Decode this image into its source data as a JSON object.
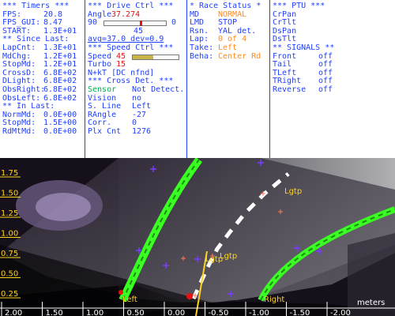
{
  "timers": {
    "title": "*** Timers ***",
    "rows": [
      {
        "k": "FPS:",
        "v": "20.8"
      },
      {
        "k": "FPS_GUI:",
        "v": "8.47"
      },
      {
        "k": "START:",
        "v": "1.3E+01"
      }
    ],
    "since_title": "** Since Last:",
    "since_rows": [
      {
        "k": "LapCnt:",
        "v": "1.3E+01"
      },
      {
        "k": "MdChg:",
        "v": "1.2E+01"
      },
      {
        "k": "StopMd:",
        "v": "1.2E+01"
      },
      {
        "k": "CrossD:",
        "v": "6.8E+02"
      },
      {
        "k": "DLight:",
        "v": "6.8E+02"
      },
      {
        "k": "ObsRight:",
        "v": "6.8E+02"
      },
      {
        "k": "ObsLeft:",
        "v": "6.8E+02"
      }
    ],
    "inlast_title": "** In Last:",
    "inlast_rows": [
      {
        "k": "NormMd:",
        "v": "0.0E+00"
      },
      {
        "k": "StopMd:",
        "v": "1.5E+00"
      },
      {
        "k": "RdMtMd:",
        "v": "0.0E+00"
      }
    ]
  },
  "drive": {
    "title": "***  Drive Ctrl  ***",
    "angle_label": "Angle",
    "angle_value": "37.274",
    "range_min": "90",
    "range_max": "0",
    "angle_fraction": 0.59,
    "center_value": "45",
    "avg_text": "avg=37.0  dev=0.9",
    "speed_title": "***  Speed Ctrl  ***",
    "speed_label": "Speed",
    "speed_value": "45",
    "speed_fraction": 0.45,
    "turbo_label": "Turbo",
    "turbo_value": "15",
    "nkt_text": "N+kT [DC nfnd]",
    "cross_title": "*** Cross Det. ***",
    "cross_rows": [
      {
        "k": "Sensor",
        "v": "Not Detect.",
        "highlight": true
      },
      {
        "k": "Vision",
        "v": "no"
      },
      {
        "k": "S. Line",
        "v": "Left"
      },
      {
        "k": "RAngle",
        "v": "-27"
      },
      {
        "k": "Corr.",
        "v": "0"
      },
      {
        "k": "Plx Cnt",
        "v": "1276"
      }
    ]
  },
  "race": {
    "title": "* Race Status *",
    "rows": [
      {
        "k": "MD",
        "v": "NORMAL",
        "orange": true
      },
      {
        "k": "LMD",
        "v": "STOP",
        "orange": false
      },
      {
        "k": "Rsn.",
        "v": "YAL det.",
        "orange": false
      },
      {
        "k": "Lap:",
        "v": "0 of 4",
        "orange": true
      },
      {
        "k": "Take:",
        "v": "Left",
        "orange": true
      },
      {
        "k": "Beha:",
        "v": "Center Rd",
        "orange": true
      }
    ]
  },
  "ptu": {
    "title": "*** PTU ***",
    "items": [
      "CrPan",
      "CrTlt",
      "DsPan",
      "DsTlt"
    ],
    "signals_title": "** SIGNALS **",
    "signals": [
      {
        "k": "Front",
        "v": "off"
      },
      {
        "k": "Tail",
        "v": "off"
      },
      {
        "k": "TLeft",
        "v": "off"
      },
      {
        "k": "TRight",
        "v": "off"
      },
      {
        "k": "Reverse",
        "v": "off"
      }
    ]
  },
  "view": {
    "y_ticks": [
      "1.75",
      "1.50",
      "1.25",
      "1.00",
      "0.75",
      "0.50",
      "0.25"
    ],
    "x_ticks": [
      "2.00",
      "1.50",
      "1.00",
      "0.50",
      "0.00",
      "-0.50",
      "-1.00",
      "-1.50",
      "-2.00"
    ],
    "x_unit": "meters",
    "labels": {
      "left": "Left",
      "right": "Right",
      "lgtp1": "Lgtp",
      "lgtp2": "Lgtp",
      "lgtp3": "Lgtp"
    },
    "colors": {
      "lane": "#39ff22",
      "marker": "#7a3cff",
      "label": "#ffd21e",
      "axis": "#ffffff"
    }
  }
}
